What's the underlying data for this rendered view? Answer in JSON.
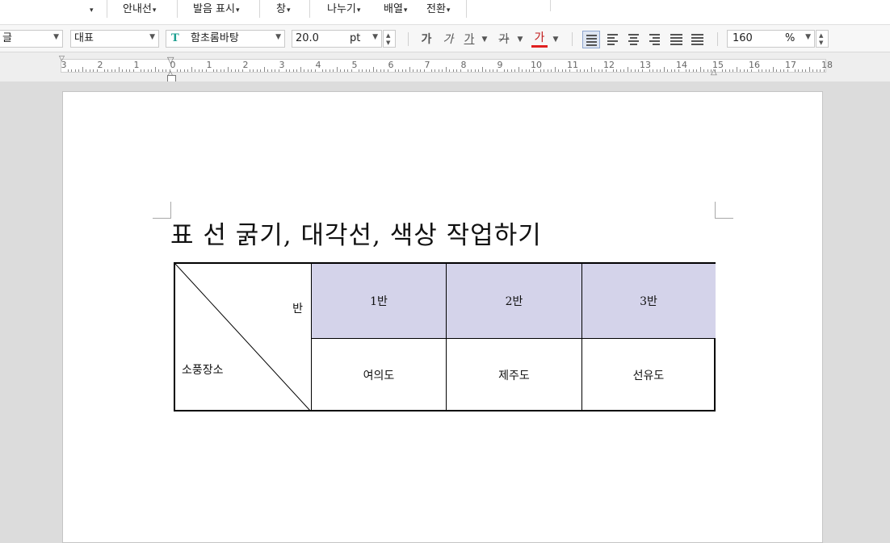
{
  "ribbon": {
    "items": [
      {
        "label": "",
        "has_dropdown": true
      },
      {
        "label": "안내선",
        "has_dropdown": true
      },
      {
        "label": "발음 표시",
        "has_dropdown": true
      },
      {
        "label": "창",
        "has_dropdown": true
      },
      {
        "label": "나누기",
        "has_dropdown": true
      },
      {
        "label": "배열",
        "has_dropdown": true
      },
      {
        "label": "전환",
        "has_dropdown": true
      }
    ]
  },
  "toolbar": {
    "language_value": "글",
    "style_value": "대표",
    "font_value": "함초롬바탕",
    "font_icon": "truetype-font-icon",
    "size_value": "20.0",
    "size_unit": "pt",
    "bold_label": "가",
    "italic_label": "가",
    "underline_label": "가",
    "strike_label": "가",
    "color_label": "가",
    "font_color": "#e02020",
    "line_spacing_value": "160",
    "line_spacing_unit": "%"
  },
  "ruler": {
    "numbers": [
      "3",
      "2",
      "1",
      "0",
      "1",
      "2",
      "3",
      "4",
      "5",
      "6",
      "7",
      "8",
      "9",
      "10",
      "11",
      "12",
      "13",
      "14",
      "15",
      "16",
      "17",
      "18"
    ]
  },
  "document": {
    "title": "표 선 굵기, 대각선, 색상 작업하기",
    "table": {
      "corner_top_label": "반",
      "corner_bottom_label": "소풍장소",
      "headers": [
        "1반",
        "2반",
        "3반"
      ],
      "row": [
        "여의도",
        "제주도",
        "선유도"
      ],
      "header_fill": "#d4d3ea"
    }
  }
}
